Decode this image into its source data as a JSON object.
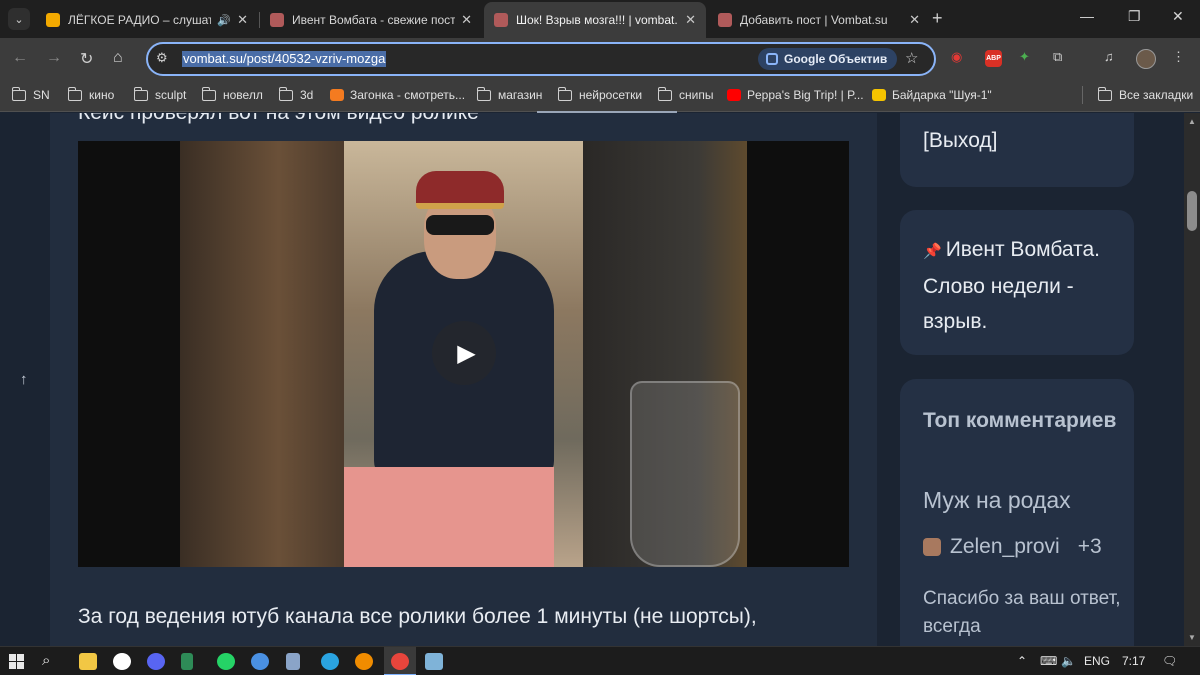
{
  "browser": {
    "tabs": [
      {
        "title": "ЛЁГКОЕ РАДИО – слушать",
        "favicon_color": "#f2a900",
        "active": false,
        "audio": true
      },
      {
        "title": "Ивент Вомбата - свежие пост",
        "favicon_color": "#b05a5a",
        "active": false,
        "audio": false
      },
      {
        "title": "Шок! Взрыв мозга!!! | vombat.",
        "favicon_color": "#b05a5a",
        "active": true,
        "audio": false
      },
      {
        "title": "Добавить пост | Vombat.su",
        "favicon_color": "#b05a5a",
        "active": false,
        "audio": false
      }
    ],
    "address": {
      "url": "vombat.su/post/40532-vzriv-mozga",
      "lens_label": "Google Объектив"
    },
    "bookmarks": [
      {
        "label": "SN",
        "type": "folder"
      },
      {
        "label": "кино",
        "type": "folder"
      },
      {
        "label": "sculpt",
        "type": "folder"
      },
      {
        "label": "новелл",
        "type": "folder"
      },
      {
        "label": "3d",
        "type": "folder"
      },
      {
        "label": "Загонка - смотреть...",
        "type": "site",
        "color": "#f47b20"
      },
      {
        "label": "магазин",
        "type": "folder"
      },
      {
        "label": "нейросетки",
        "type": "folder"
      },
      {
        "label": "снипы",
        "type": "folder"
      },
      {
        "label": "Peppa's Big Trip! | P...",
        "type": "site",
        "color": "#ff0000"
      },
      {
        "label": "Байдарка \"Шуя-1\"",
        "type": "site",
        "color": "#f5c400"
      }
    ],
    "all_bookmarks_label": "Все закладки"
  },
  "post": {
    "cut_heading": "Кейс проверял вот на этом видео ролике",
    "paragraph": "За год ведения ютуб канала все ролики более 1 минуты (не шортсы),",
    "video": {
      "play_icon": "▶"
    }
  },
  "sidebar": {
    "logout_label": "[Выход]",
    "event_pin_icon": "📌",
    "event_text": "Ивент Вомбата. Слово недели - взрыв.",
    "top_comments_title": "Топ комментариев",
    "top_post_title": "Муж на родах",
    "comment": {
      "author": "Zelen_provi",
      "score": "+3",
      "text": "Спасибо за ваш ответ, всегда"
    }
  },
  "taskbar": {
    "language": "ENG",
    "time": "7:17",
    "apps": [
      {
        "name": "file-explorer",
        "color": "#f2c744"
      },
      {
        "name": "yandex",
        "color": "#ffffff"
      },
      {
        "name": "discord",
        "color": "#5865f2"
      },
      {
        "name": "game-app",
        "color": "#2e8b57"
      },
      {
        "name": "whatsapp",
        "color": "#25d366"
      },
      {
        "name": "chromium",
        "color": "#4a90e2"
      },
      {
        "name": "calculator",
        "color": "#8aa4c8"
      },
      {
        "name": "telegram",
        "color": "#2aa3e0"
      },
      {
        "name": "blender",
        "color": "#f08c00"
      },
      {
        "name": "chrome",
        "color": "#e8453c"
      },
      {
        "name": "photos",
        "color": "#7fb3d8"
      }
    ]
  }
}
